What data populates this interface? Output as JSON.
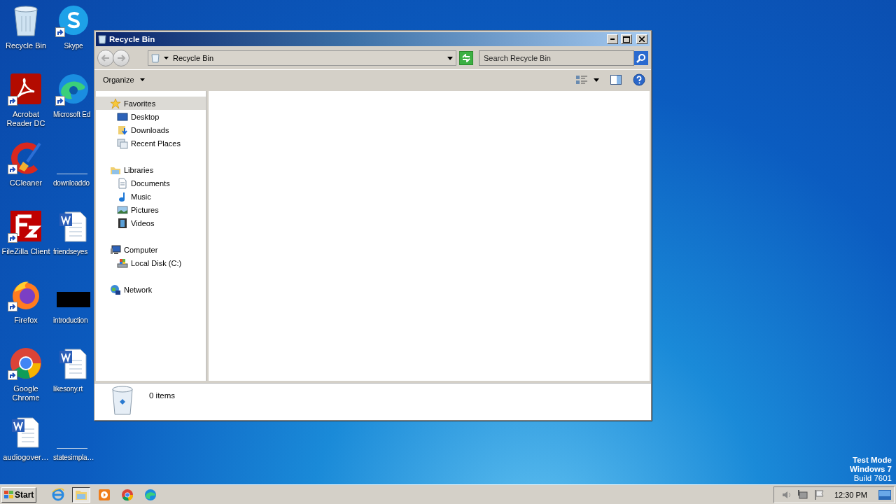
{
  "desktop_icons": [
    {
      "label": "Recycle Bin",
      "kind": "recycle",
      "shortcut": false
    },
    {
      "label": "Skype",
      "kind": "skype",
      "shortcut": true
    },
    {
      "label": "Acrobat Reader DC",
      "kind": "acrobat",
      "shortcut": true
    },
    {
      "label": "Microsoft Ed",
      "kind": "edge",
      "shortcut": true
    },
    {
      "label": "CCleaner",
      "kind": "ccleaner",
      "shortcut": true
    },
    {
      "label": "downloaddo",
      "kind": "blank",
      "shortcut": false
    },
    {
      "label": "FileZilla Client",
      "kind": "filezilla",
      "shortcut": true
    },
    {
      "label": "friendseyes",
      "kind": "word",
      "shortcut": false
    },
    {
      "label": "Firefox",
      "kind": "firefox",
      "shortcut": true
    },
    {
      "label": "introduction",
      "kind": "blackbox",
      "shortcut": false
    },
    {
      "label": "Google Chrome",
      "kind": "chrome",
      "shortcut": true
    },
    {
      "label": "likesony.rt",
      "kind": "word",
      "shortcut": false
    },
    {
      "label": "audiogover…",
      "kind": "word",
      "shortcut": false
    },
    {
      "label": "statesimpla…",
      "kind": "blank",
      "shortcut": false
    }
  ],
  "window": {
    "title": "Recycle Bin",
    "address": "Recycle Bin",
    "search": {
      "placeholder": "Search Recycle Bin"
    },
    "organize": "Organize",
    "nav": [
      {
        "label": "Favorites",
        "kind": "star",
        "selected": true,
        "children": [
          {
            "label": "Desktop",
            "kind": "desktop",
            "selected": false
          },
          {
            "label": "Downloads",
            "kind": "downloads",
            "selected": false
          },
          {
            "label": "Recent Places",
            "kind": "recent",
            "selected": false
          }
        ]
      },
      {
        "label": "Libraries",
        "kind": "libraries",
        "selected": false,
        "children": [
          {
            "label": "Documents",
            "kind": "documents",
            "selected": false
          },
          {
            "label": "Music",
            "kind": "music",
            "selected": false
          },
          {
            "label": "Pictures",
            "kind": "pictures",
            "selected": false
          },
          {
            "label": "Videos",
            "kind": "videos",
            "selected": false
          }
        ]
      },
      {
        "label": "Computer",
        "kind": "computer",
        "selected": false,
        "children": [
          {
            "label": "Local Disk (C:)",
            "kind": "disk",
            "selected": false
          }
        ]
      },
      {
        "label": "Network",
        "kind": "network",
        "selected": false
      }
    ],
    "status": "0 items"
  },
  "os_notice": [
    "Test Mode",
    "Windows 7",
    "Build 7601"
  ],
  "taskbar": {
    "start": "Start",
    "apps": [
      {
        "kind": "ie",
        "selected": false
      },
      {
        "kind": "explorer",
        "selected": true
      },
      {
        "kind": "media",
        "selected": false
      },
      {
        "kind": "chrome",
        "selected": false
      },
      {
        "kind": "edge",
        "selected": false
      }
    ],
    "clock": "12:30 PM"
  }
}
